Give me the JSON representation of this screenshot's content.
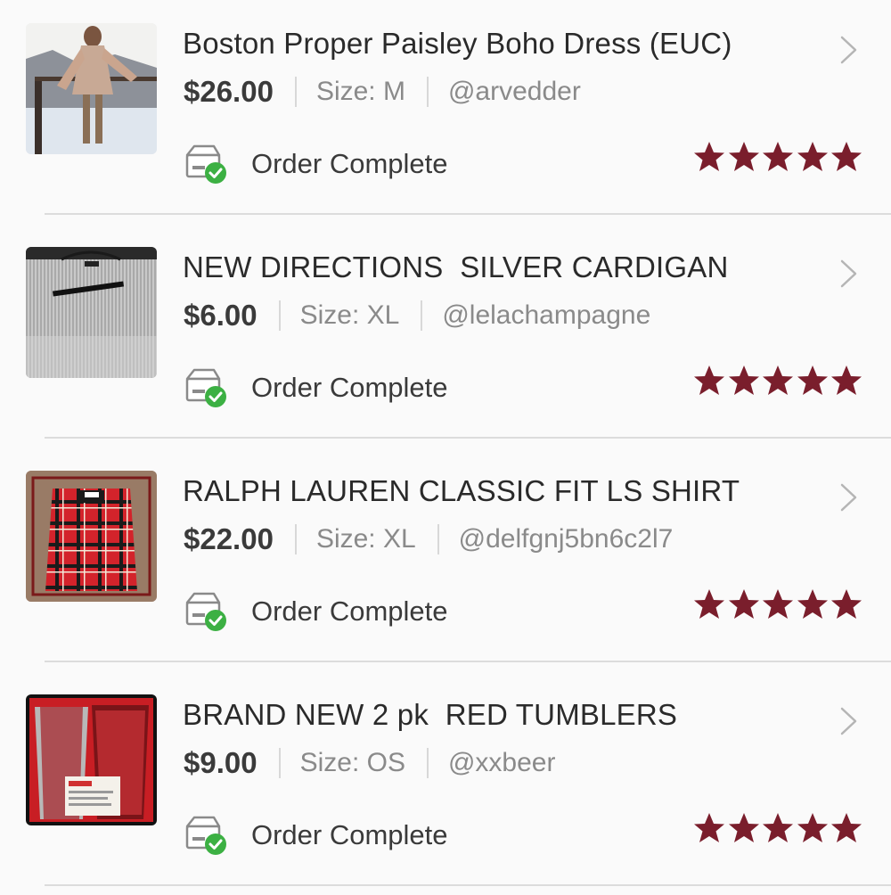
{
  "theme": {
    "star_color": "#7a1e2c",
    "check_color": "#3cb043"
  },
  "orders": [
    {
      "title": "Boston Proper Paisley Boho Dress (EUC)",
      "price": "$26.00",
      "size": "Size: M",
      "seller": "@arvedder",
      "status": "Order Complete",
      "rating": 5
    },
    {
      "title": "NEW DIRECTIONS  SILVER CARDIGAN",
      "price": "$6.00",
      "size": "Size: XL",
      "seller": "@lelachampagne",
      "status": "Order Complete",
      "rating": 5
    },
    {
      "title": "RALPH LAUREN CLASSIC FIT LS SHIRT",
      "price": "$22.00",
      "size": "Size: XL",
      "seller": "@delfgnj5bn6c2l7",
      "status": "Order Complete",
      "rating": 5
    },
    {
      "title": "BRAND NEW 2 pk  RED TUMBLERS",
      "price": "$9.00",
      "size": "Size: OS",
      "seller": "@xxbeer",
      "status": "Order Complete",
      "rating": 5
    }
  ]
}
